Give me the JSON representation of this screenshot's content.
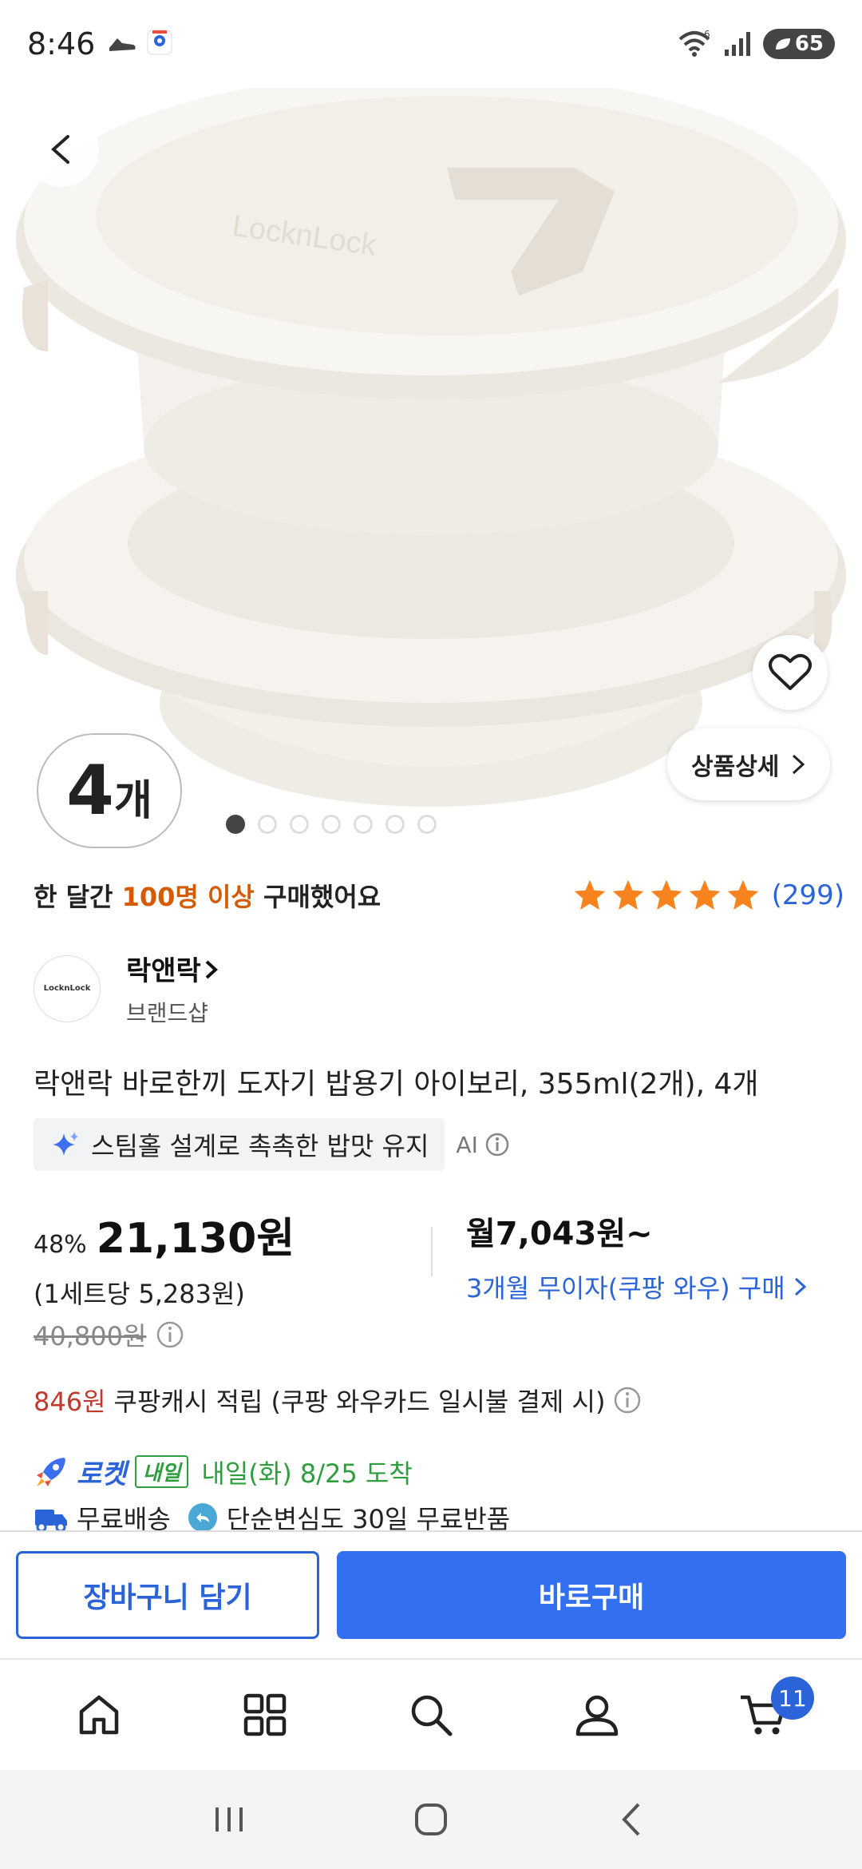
{
  "status_bar": {
    "time": "8:46",
    "network": "6",
    "battery": "65"
  },
  "hero": {
    "count_number": "4",
    "count_unit": "개",
    "detail_label": "상품상세",
    "image_label": "LocknLock",
    "dots_total": 7,
    "dots_active": 1
  },
  "purchase": {
    "prefix": "한 달간 ",
    "highlight": "100명 이상",
    "suffix": " 구매했어요"
  },
  "rating": {
    "stars": 5,
    "count": "(299)",
    "star_color": "#f7831f"
  },
  "brand": {
    "logo_text": "LocknLock",
    "name": "락앤락",
    "sub": "브랜드샵"
  },
  "product": {
    "title": "락앤락 바로한끼 도자기 밥용기 아이보리, 355ml(2개), 4개",
    "ai_summary": "스팀홀 설계로 촉촉한 밥맛 유지",
    "ai_label": "AI"
  },
  "price": {
    "discount": "48%",
    "price": "21,130원",
    "per_set": "(1세트당 5,283원)",
    "original": "40,800원",
    "monthly": "월7,043원~",
    "installment": "3개월 무이자(쿠팡 와우) 구매"
  },
  "cashback": {
    "amount": "846원",
    "text": "쿠팡캐시 적립 (쿠팡 와우카드 일시불 결제 시)"
  },
  "delivery": {
    "rocket": "로켓",
    "tag": "내일",
    "arrival": "내일(화) 8/25 도착",
    "free_shipping": "무료배송",
    "return_policy": "단순변심도 30일 무료반품"
  },
  "actions": {
    "cart": "장바구니 담기",
    "buy": "바로구매"
  },
  "bottom_nav": {
    "cart_badge": "11"
  },
  "colors": {
    "accent_blue": "#3370ef",
    "link_blue": "#2b64d8",
    "highlight_orange": "#d65a00",
    "delivery_green": "#2e9e3e",
    "cash_red": "#c0392b"
  }
}
